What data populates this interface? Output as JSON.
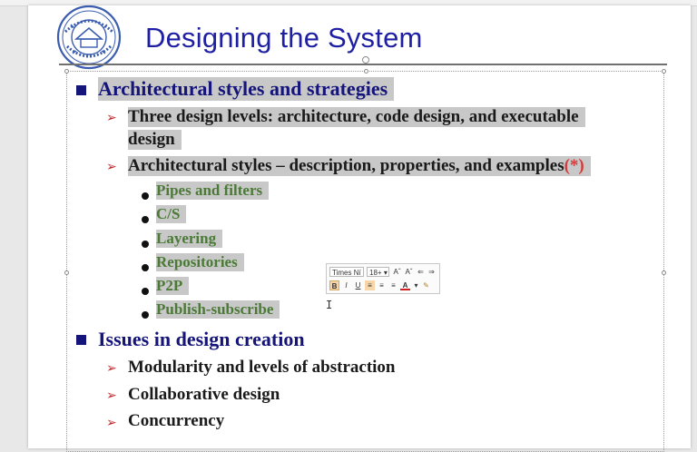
{
  "slide": {
    "title": "Designing the System",
    "items": [
      {
        "level": 1,
        "text": "Architectural styles and strategies"
      },
      {
        "level": 2,
        "text": "Three design levels: architecture, code design, and executable"
      },
      {
        "level": 2,
        "text": "design"
      },
      {
        "level": 2,
        "text": "Architectural styles – description, properties, and examples",
        "suffix": "(*)"
      },
      {
        "level": 3,
        "text": "Pipes and filters"
      },
      {
        "level": 3,
        "text": "C/S"
      },
      {
        "level": 3,
        "text": "Layering"
      },
      {
        "level": 3,
        "text": "Repositories"
      },
      {
        "level": 3,
        "text": "P2P"
      },
      {
        "level": 3,
        "text": "Publish-subscribe"
      },
      {
        "level": 1,
        "text": "Issues in design creation"
      },
      {
        "level": 2,
        "text": "Modularity and levels of abstraction"
      },
      {
        "level": 2,
        "text": "Collaborative design"
      },
      {
        "level": 2,
        "text": "Concurrency"
      }
    ]
  },
  "mini_toolbar": {
    "font_name": "Times Ní",
    "font_size": "18+",
    "grow_font": "Aˆ",
    "shrink_font": "Aˇ",
    "bold": "B",
    "italic": "I",
    "underline": "U",
    "font_color": "A"
  },
  "colors": {
    "title": "#1f1fa3",
    "level1": "#14147a",
    "level3": "#4a7a36",
    "accent_red": "#d23c3c",
    "selection": "#c8c8c8"
  },
  "icons": {
    "logo": "university-seal-icon",
    "level1_bullet": "square-bullet-icon",
    "level2_bullet": "arrow-bullet-icon",
    "level3_bullet": "round-bullet-icon",
    "text_cursor": "i-beam-cursor-icon"
  }
}
